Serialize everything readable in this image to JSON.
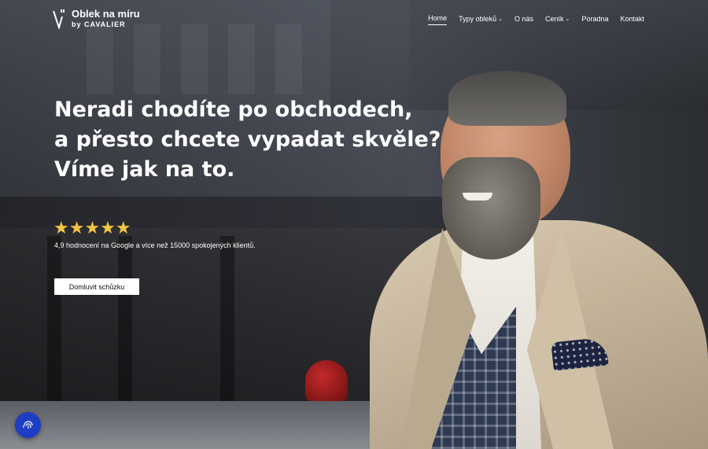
{
  "brand": {
    "name": "Oblek na míru",
    "sub": "by CAVALIER"
  },
  "nav": {
    "items": [
      {
        "label": "Home",
        "active": true,
        "dropdown": false
      },
      {
        "label": "Typy obleků",
        "active": false,
        "dropdown": true
      },
      {
        "label": "O nás",
        "active": false,
        "dropdown": false
      },
      {
        "label": "Ceník",
        "active": false,
        "dropdown": true
      },
      {
        "label": "Poradna",
        "active": false,
        "dropdown": false
      },
      {
        "label": "Kontakt",
        "active": false,
        "dropdown": false
      }
    ]
  },
  "hero": {
    "headline_lines": [
      "Neradi chodíte po obchodech,",
      "a přesto chcete vypadat skvěle?",
      "Víme jak na to."
    ],
    "stars": "★★★★★",
    "rating_text": "4,9 hodnocení na Google a více než 15000 spokojených klientů.",
    "cta_label": "Domluvit schůzku"
  },
  "icons": {
    "logo": "logo-mark-icon",
    "dropdown": "chevron-down-icon",
    "fab": "fingerprint-icon"
  },
  "colors": {
    "text": "#ffffff",
    "stars": "#f5c542",
    "fab": "#1e3cc4"
  }
}
